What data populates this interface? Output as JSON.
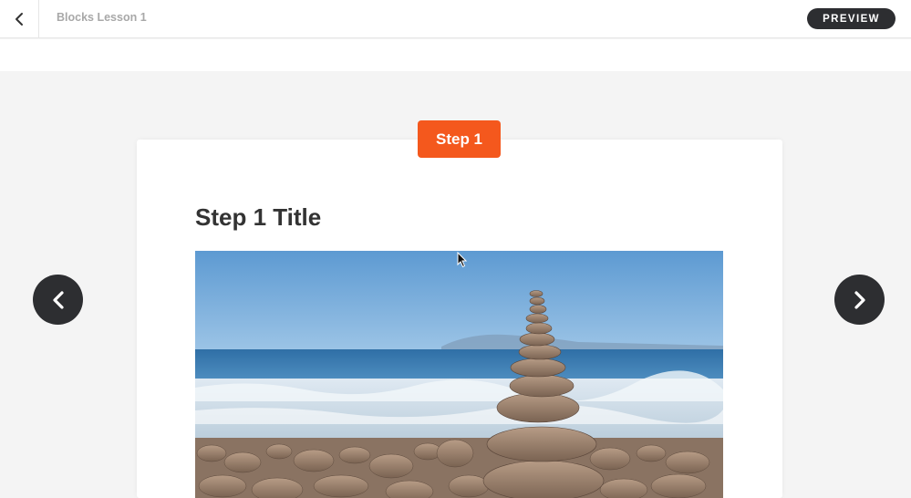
{
  "header": {
    "lesson_title": "Blocks Lesson 1",
    "preview_label": "PREVIEW"
  },
  "step": {
    "badge_label": "Step 1",
    "title": "Step 1 Title"
  },
  "icons": {
    "back": "chevron-left-icon",
    "prev": "chevron-left-icon",
    "next": "chevron-right-icon"
  },
  "colors": {
    "accent": "#f4581d",
    "dark": "#2d2e31",
    "background": "#f4f4f4"
  }
}
